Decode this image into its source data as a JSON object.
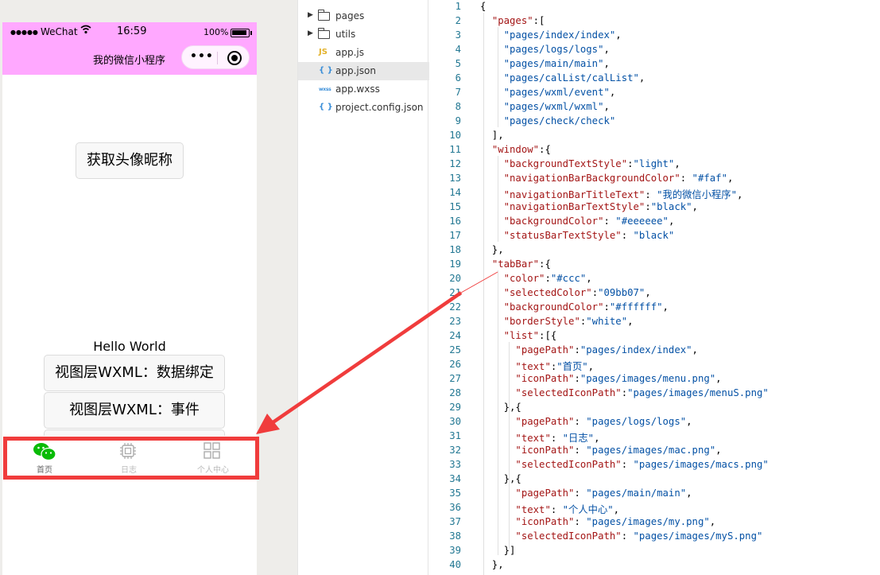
{
  "status_bar": {
    "signal": "●●●●●",
    "carrier": "WeChat",
    "time": "16:59",
    "battery": "100%"
  },
  "nav_bar": {
    "title": "我的微信小程序",
    "menu_dots": "•••"
  },
  "page": {
    "avatar_button": "获取头像昵称",
    "hello_text": "Hello World",
    "bind_button": "视图层WXML：数据绑定",
    "event_button": "视图层WXML：事件"
  },
  "tab_bar": {
    "items": [
      {
        "label": "首页",
        "icon": "wechat-icon"
      },
      {
        "label": "日志",
        "icon": "chip-icon"
      },
      {
        "label": "个人中心",
        "icon": "grid-icon"
      }
    ]
  },
  "file_tree": {
    "items": [
      {
        "name": "pages",
        "type": "folder"
      },
      {
        "name": "utils",
        "type": "folder"
      },
      {
        "name": "app.js",
        "type": "js",
        "badge": "JS"
      },
      {
        "name": "app.json",
        "type": "json",
        "badge": "{ }"
      },
      {
        "name": "app.wxss",
        "type": "wxss",
        "badge": "wxss"
      },
      {
        "name": "project.config.json",
        "type": "json",
        "badge": "{ }"
      }
    ]
  },
  "code_lines": [
    "{",
    "  \"pages\":[",
    "    \"pages/index/index\",",
    "    \"pages/logs/logs\",",
    "    \"pages/main/main\",",
    "    \"pages/calList/calList\",",
    "    \"pages/wxml/event\",",
    "    \"pages/wxml/wxml\",",
    "    \"pages/check/check\"",
    "  ],",
    "  \"window\":{",
    "    \"backgroundTextStyle\":\"light\",",
    "    \"navigationBarBackgroundColor\": \"#faf\",",
    "    \"navigationBarTitleText\": \"我的微信小程序\",",
    "    \"navigationBarTextStyle\":\"black\",",
    "    \"backgroundColor\": \"#eeeeee\",",
    "    \"statusBarTextStyle\": \"black\"",
    "  },",
    "  \"tabBar\":{",
    "    \"color\":\"#ccc\",",
    "    \"selectedColor\":\"09bb07\",",
    "    \"backgroundColor\":\"#ffffff\",",
    "    \"borderStyle\":\"white\",",
    "    \"list\":[{",
    "      \"pagePath\":\"pages/index/index\",",
    "      \"text\":\"首页\",",
    "      \"iconPath\":\"pages/images/menu.png\",",
    "      \"selectedIconPath\":\"pages/images/menuS.png\"",
    "    },{",
    "      \"pagePath\": \"pages/logs/logs\",",
    "      \"text\": \"日志\",",
    "      \"iconPath\": \"pages/images/mac.png\",",
    "      \"selectedIconPath\": \"pages/images/macs.png\"",
    "    },{",
    "      \"pagePath\": \"pages/main/main\",",
    "      \"text\": \"个人中心\",",
    "      \"iconPath\": \"pages/images/my.png\",",
    "      \"selectedIconPath\": \"pages/images/myS.png\"",
    "    }]",
    "  },"
  ],
  "colors": {
    "nav_bg": "#ffa8ff",
    "highlight": "#f03c3c",
    "line_number": "#237893",
    "json_key": "#a31515",
    "json_string": "#0451a5",
    "tab_selected": "#09bb07"
  }
}
